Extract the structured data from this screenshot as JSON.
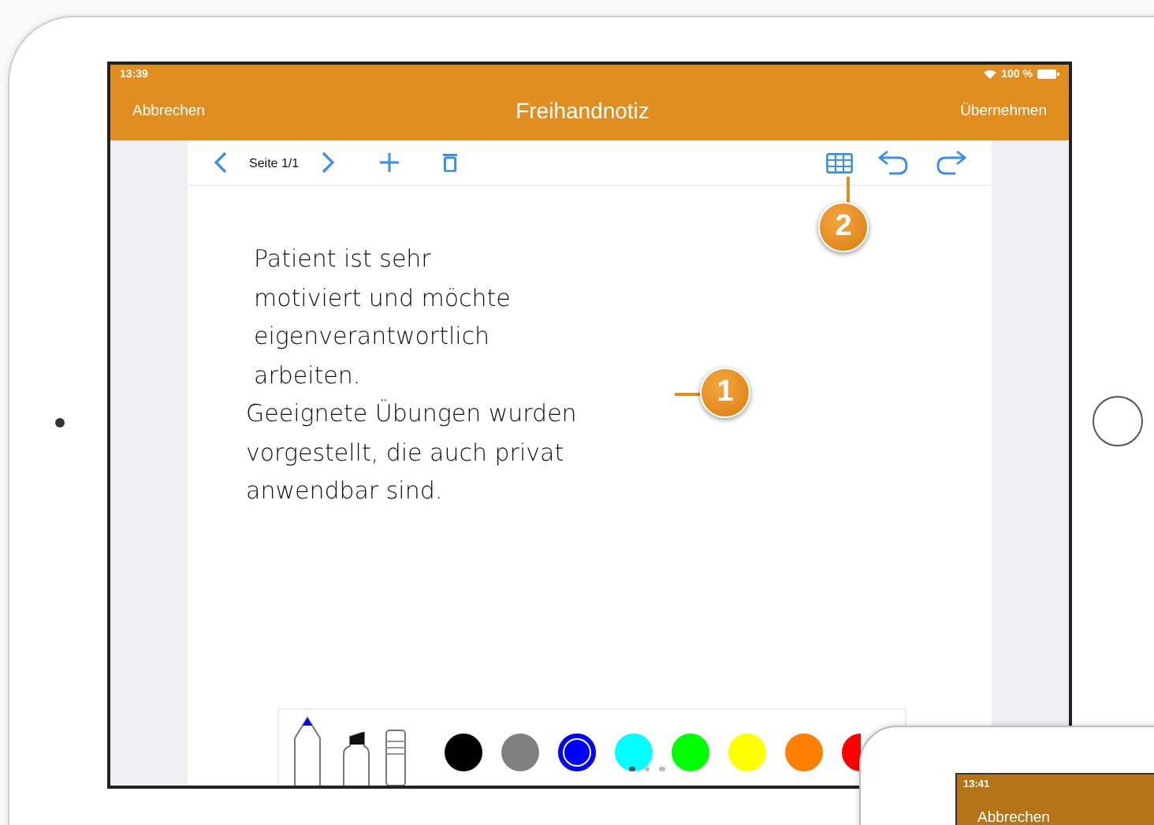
{
  "status_bar": {
    "time": "13:39",
    "battery": "100 %"
  },
  "nav_bar": {
    "cancel": "Abbrechen",
    "title": "Freihandnotiz",
    "apply": "Übernehmen"
  },
  "toolbar": {
    "page": "Seite 1/1"
  },
  "note_lines": [
    "Patient ist sehr",
    "motiviert und möchte",
    "eigenverantwortlich",
    "arbeiten.",
    "Geeignete Übungen wurden",
    "vorgestellt, die auch privat",
    "anwendbar sind."
  ],
  "callouts": [
    "1",
    "2"
  ],
  "tools": [
    {
      "kind": "pen"
    },
    {
      "kind": "marker"
    },
    {
      "kind": "eraser"
    }
  ],
  "colors": [
    {
      "color": "#000000",
      "selected": false
    },
    {
      "color": "#808080",
      "selected": false
    },
    {
      "color": "#0000ff",
      "selected": true
    },
    {
      "color": "#00ffff",
      "selected": false
    },
    {
      "color": "#00ff00",
      "selected": false
    },
    {
      "color": "#ffff00",
      "selected": false
    },
    {
      "color": "#ff8000",
      "selected": false
    },
    {
      "color": "#ff0000",
      "selected": false
    }
  ],
  "page_dots": [
    {
      "selected": true
    },
    {
      "selected": false
    },
    {
      "selected": false
    }
  ],
  "second_device": {
    "time": "13:41",
    "cancel": "Abbrechen"
  }
}
